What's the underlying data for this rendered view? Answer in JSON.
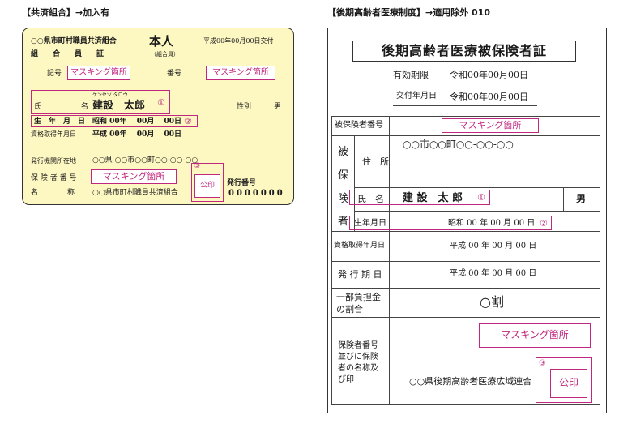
{
  "left_heading": "【共済組合】→加入有",
  "right_heading": "【後期高齢者医療制度】→適用除外 010",
  "mask_label": "マスキング箇所",
  "seal_label": "公印",
  "marker_1": "①",
  "marker_2": "②",
  "marker_3": "③",
  "left_card": {
    "issuer_line1": "○○県市町村職員共済組合",
    "issuer_line2": "組　　合　　員　　証",
    "person_type": "本人",
    "member_note": "（組合員）",
    "issue_date": "平成00年00月00日交付",
    "symbol_label": "記号",
    "number_label": "番号",
    "name_kana": "ケンセツ タロウ",
    "name_label_1": "氏",
    "name_label_2": "名",
    "name_value": "建設　太郎",
    "gender_label": "性別",
    "gender_value": "男",
    "dob_label": "生　年　月　日",
    "dob_value": "昭和 00年　 00月　 00日",
    "qualification_label": "資格取得年月日",
    "qualification_value": "平成 00年　 00月　 00日",
    "issuer_address_label": "発行機関所在地",
    "issuer_address_value": "○○県 ○○市○○町○○-○○-○○",
    "insurer_number_label": "保 険 者 番 号",
    "insurer_name_label": "名　　　　称",
    "insurer_name_value": "○○県市町村職員共済組合",
    "issue_number_label": "発行番号",
    "issue_number_value": "0000000"
  },
  "right_card": {
    "title": "後期高齢者医療被保険者証",
    "validity_label": "有効期限",
    "validity_value": "令和00年00月00日",
    "delivery_label": "交付年月日",
    "delivery_value": "令和00年00月00日",
    "insured_number_label": "被保険者番号",
    "side_label_1": "被",
    "side_label_2": "保",
    "side_label_3": "険",
    "side_label_4": "者",
    "address_label": "住　所",
    "address_value": "○○市○○町○○-○○-○○",
    "name_label": "氏　名",
    "name_value": "建 設　太 郎",
    "gender_value": "男",
    "dob_label": "生年月日",
    "dob_value": "昭和 00 年 00 月 00 日",
    "qualification_label": "資格取得年月日",
    "qualification_value": "平成 00 年 00 月 00 日",
    "issue_label": "発 行 期 日",
    "issue_value": "平成 00 年 00 月 00 日",
    "copay_label_1": "一部負担金",
    "copay_label_2": "の割合",
    "copay_value": "○割",
    "insurer_label_1": "保険者番号",
    "insurer_label_2": "並びに保険",
    "insurer_label_3": "者の名称及",
    "insurer_label_4": "び印",
    "insurer_name_value": "○○県後期高齢者医療広域連合"
  }
}
